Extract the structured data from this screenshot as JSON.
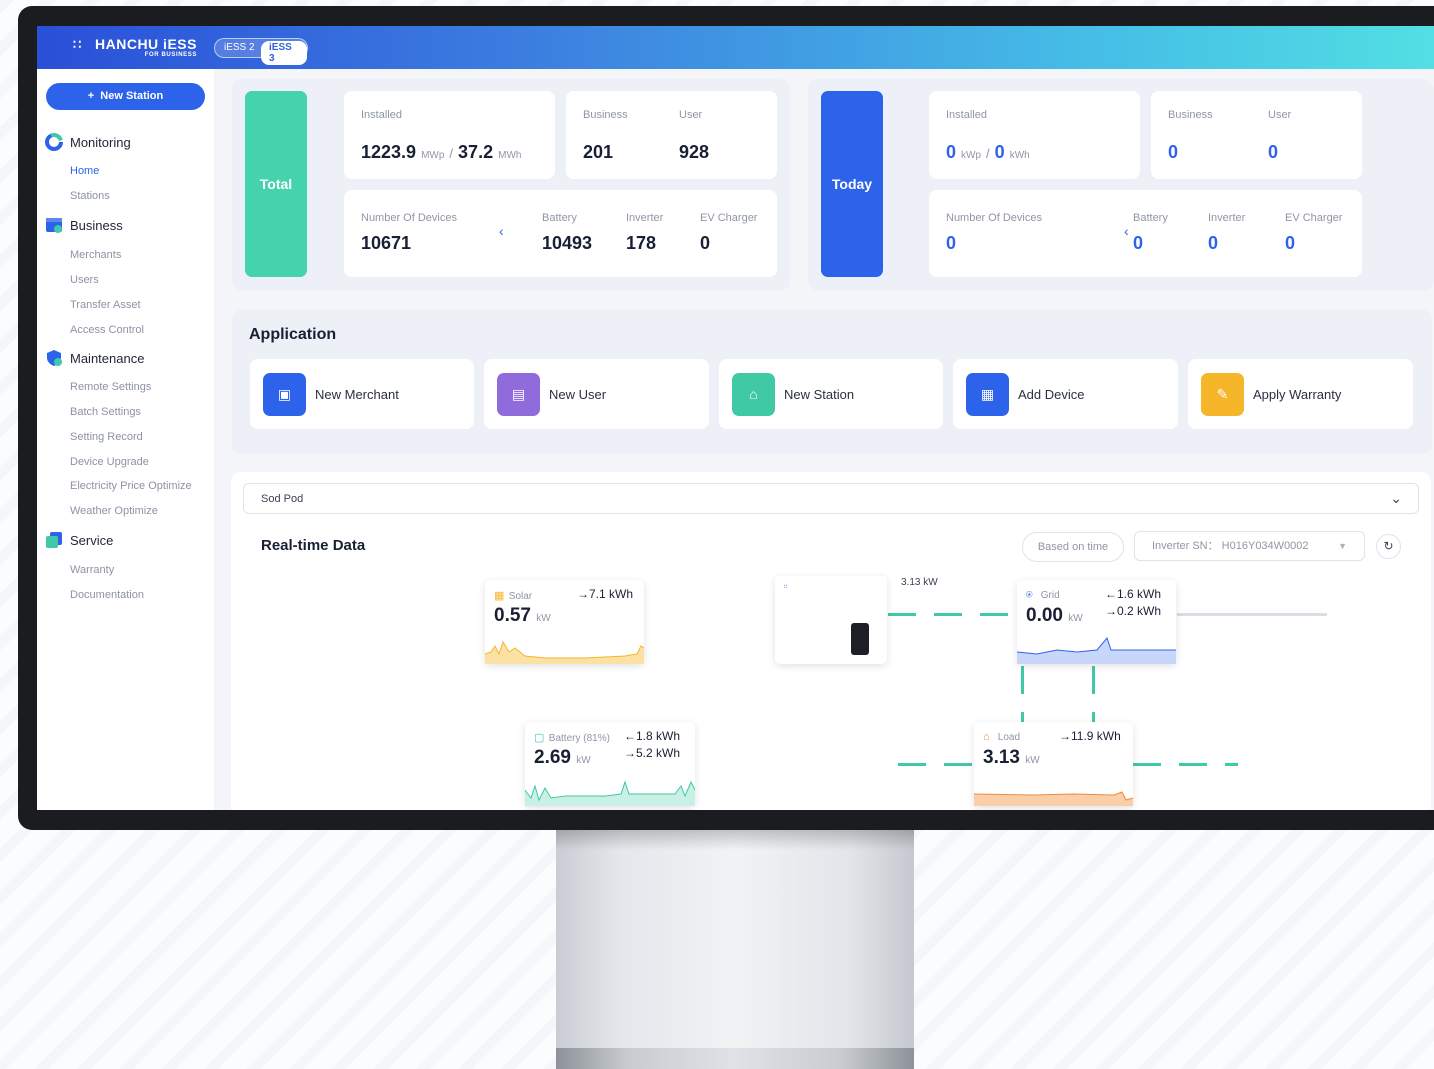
{
  "header": {
    "logo_name": "HANCHU iESS",
    "logo_sub": "FOR BUSINESS",
    "version_a": "iESS 2",
    "version_b": "iESS 3"
  },
  "sidebar": {
    "new_station_label": "New Station",
    "sections": [
      {
        "label": "Monitoring",
        "items": [
          "Home",
          "Stations"
        ]
      },
      {
        "label": "Business",
        "items": [
          "Merchants",
          "Users",
          "Transfer Asset",
          "Access Control"
        ]
      },
      {
        "label": "Maintenance",
        "items": [
          "Remote Settings",
          "Batch Settings",
          "Setting Record",
          "Device Upgrade",
          "Electricity Price Optimize",
          "Weather Optimize"
        ]
      },
      {
        "label": "Service",
        "items": [
          "Warranty",
          "Documentation"
        ]
      }
    ]
  },
  "total": {
    "label": "Total",
    "installed_label": "Installed",
    "installed_power": "1223.9",
    "installed_power_unit": "MWp",
    "installed_energy": "37.2",
    "installed_energy_unit": "MWh",
    "business_label": "Business",
    "business": "201",
    "user_label": "User",
    "user": "928",
    "devices_label": "Number Of Devices",
    "devices": "10671",
    "battery_label": "Battery",
    "battery": "10493",
    "inverter_label": "Inverter",
    "inverter": "178",
    "ev_label": "EV Charger",
    "ev": "0"
  },
  "today": {
    "label": "Today",
    "installed_label": "Installed",
    "installed_power": "0",
    "installed_power_unit": "kWp",
    "installed_energy": "0",
    "installed_energy_unit": "kWh",
    "business_label": "Business",
    "business": "0",
    "user_label": "User",
    "user": "0",
    "devices_label": "Number Of Devices",
    "devices": "0",
    "battery_label": "Battery",
    "battery": "0",
    "inverter_label": "Inverter",
    "inverter": "0",
    "ev_label": "EV Charger",
    "ev": "0"
  },
  "application": {
    "title": "Application",
    "items": [
      {
        "label": "New Merchant",
        "color": "#2d63ea"
      },
      {
        "label": "New User",
        "color": "#8f6bdc"
      },
      {
        "label": "New Station",
        "color": "#3fc9a4"
      },
      {
        "label": "Add Device",
        "color": "#2d63ea"
      },
      {
        "label": "Apply Warranty",
        "color": "#f5b62a"
      }
    ]
  },
  "realtime": {
    "station_select": "Sod Pod",
    "title": "Real-time Data",
    "based_on": "Based on time",
    "inverter_sn": "Inverter SN： H016Y034W0002",
    "inverter_power": "3.13 kW",
    "solar": {
      "label": "Solar",
      "value": "0.57",
      "unit": "kW",
      "energy": "→7.1 kWh"
    },
    "grid": {
      "label": "Grid",
      "value": "0.00",
      "unit": "kW",
      "import": "←1.6 kWh",
      "export": "→0.2 kWh"
    },
    "battery": {
      "label": "Battery (81%)",
      "value": "2.69",
      "unit": "kW",
      "charge": "←1.8 kWh",
      "discharge": "→5.2 kWh"
    },
    "load": {
      "label": "Load",
      "value": "3.13",
      "unit": "kW",
      "energy": "→11.9 kWh"
    }
  },
  "colors": {
    "primary": "#2d63ea",
    "teal": "#3fc9a4",
    "solar": "#f5b62a",
    "load": "#ef8a3c"
  }
}
